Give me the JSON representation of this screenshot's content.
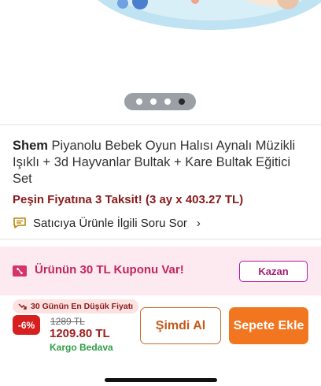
{
  "product": {
    "brand": "Shem",
    "title": "Piyanolu Bebek Oyun Halısı Aynalı Müzikli Işıklı + 3d Hayvanlar Bultak + Kare Bultak Eğitici Set",
    "installment": "Peşin Fiyatına 3 Taksit! (3 ay x 403.27 TL)"
  },
  "gallery": {
    "page_count": 4,
    "active_page": 4
  },
  "seller_question": {
    "label": "Satıcıya Ürünle İlgili Soru Sor",
    "chevron": "›",
    "icon": "chat-bubble-icon"
  },
  "coupon": {
    "text": "Ürünün 30 TL Kuponu Var!",
    "button": "Kazan",
    "icon": "coupon-ticket-icon"
  },
  "price": {
    "lowest_badge": "30 Günün En Düşük Fiyatı",
    "discount": "-6%",
    "old_price": "1289 TL",
    "new_price": "1209.80 TL",
    "cargo": "Kargo Bedava"
  },
  "actions": {
    "buy_now": "Şimdi Al",
    "add_to_cart": "Sepete Ekle"
  },
  "colors": {
    "installment": "#8b1a1a",
    "coupon_bg": "#fde9f0",
    "buy_now_border": "#c96a2a",
    "add_to_cart_bg": "#f2751f",
    "discount_bg": "#d61f1f",
    "cargo": "#2f9e44"
  }
}
